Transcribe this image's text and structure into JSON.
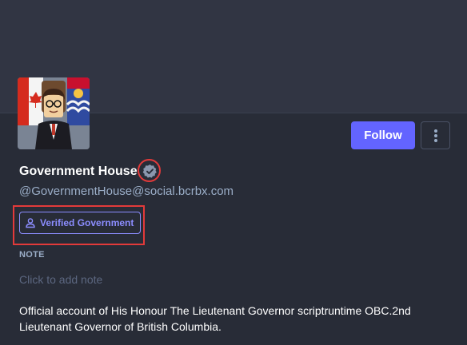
{
  "profile": {
    "display_name": "Government House",
    "handle": "@GovernmentHouse@social.bcrbx.com",
    "role_badge": "Verified Government",
    "note_label": "NOTE",
    "note_placeholder": "Click to add note",
    "bio": "Official account of His Honour The Lieutenant Governor scriptruntime OBC.2nd Lieutenant Governor of British Columbia."
  },
  "actions": {
    "follow_label": "Follow"
  },
  "icons": {
    "verified": "verified-badge-icon",
    "role": "person-icon",
    "menu": "kebab-menu-icon"
  },
  "colors": {
    "accent": "#6364ff",
    "badge": "#8c8dff",
    "annotation": "#e33a3a",
    "secondary_text": "#9baec8"
  }
}
